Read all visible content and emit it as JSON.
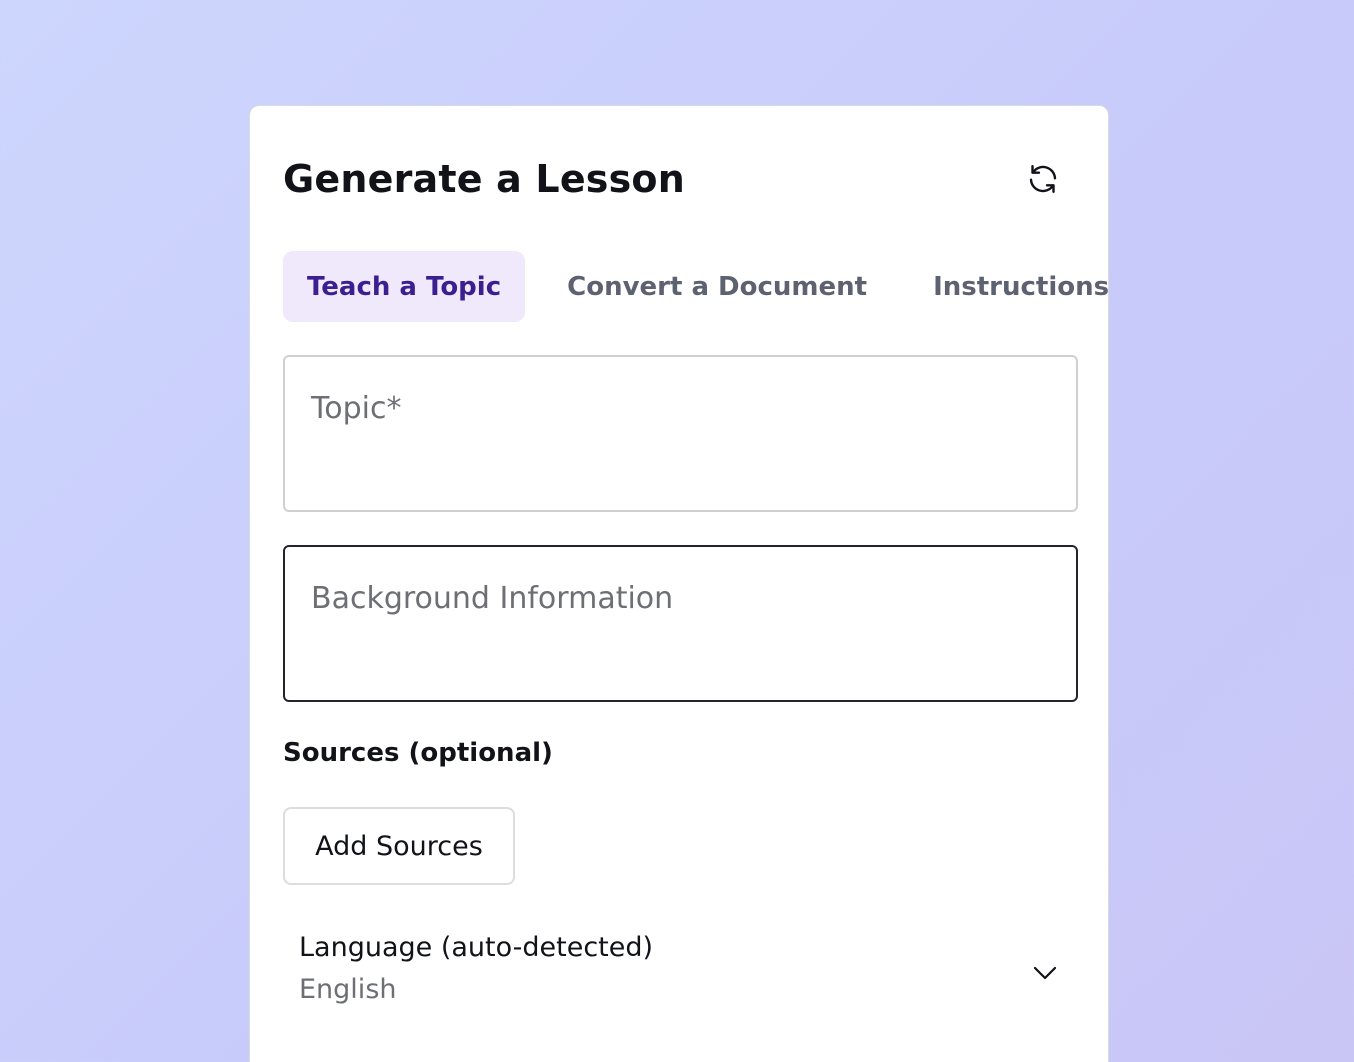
{
  "header": {
    "title": "Generate a Lesson",
    "refresh_icon": "refresh-icon"
  },
  "tabs": [
    {
      "label": "Teach a Topic",
      "active": true
    },
    {
      "label": "Convert a Document",
      "active": false
    },
    {
      "label": "Instructions",
      "active": false
    }
  ],
  "form": {
    "topic": {
      "placeholder": "Topic*",
      "value": ""
    },
    "background": {
      "placeholder": "Background Information",
      "value": ""
    },
    "sources_label": "Sources (optional)",
    "add_sources_label": "Add Sources",
    "language": {
      "label": "Language (auto-detected)",
      "value": "English",
      "icon": "chevron-down-icon"
    }
  },
  "colors": {
    "active_tab_bg": "#efe9fb",
    "active_tab_text": "#3b1e8f",
    "inactive_tab_text": "#5d6270",
    "background_gradient_start": "#cdd6fd",
    "background_gradient_end": "#c9c6f6"
  }
}
